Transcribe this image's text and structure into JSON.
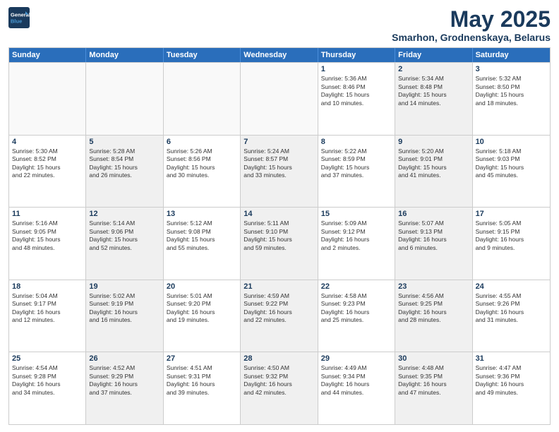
{
  "header": {
    "logo_line1": "General",
    "logo_line2": "Blue",
    "month": "May 2025",
    "location": "Smarhon, Grodnenskaya, Belarus"
  },
  "day_headers": [
    "Sunday",
    "Monday",
    "Tuesday",
    "Wednesday",
    "Thursday",
    "Friday",
    "Saturday"
  ],
  "weeks": [
    [
      {
        "num": "",
        "info": "",
        "empty": true
      },
      {
        "num": "",
        "info": "",
        "empty": true
      },
      {
        "num": "",
        "info": "",
        "empty": true
      },
      {
        "num": "",
        "info": "",
        "empty": true
      },
      {
        "num": "1",
        "info": "Sunrise: 5:36 AM\nSunset: 8:46 PM\nDaylight: 15 hours\nand 10 minutes."
      },
      {
        "num": "2",
        "info": "Sunrise: 5:34 AM\nSunset: 8:48 PM\nDaylight: 15 hours\nand 14 minutes.",
        "shaded": true
      },
      {
        "num": "3",
        "info": "Sunrise: 5:32 AM\nSunset: 8:50 PM\nDaylight: 15 hours\nand 18 minutes."
      }
    ],
    [
      {
        "num": "4",
        "info": "Sunrise: 5:30 AM\nSunset: 8:52 PM\nDaylight: 15 hours\nand 22 minutes."
      },
      {
        "num": "5",
        "info": "Sunrise: 5:28 AM\nSunset: 8:54 PM\nDaylight: 15 hours\nand 26 minutes.",
        "shaded": true
      },
      {
        "num": "6",
        "info": "Sunrise: 5:26 AM\nSunset: 8:56 PM\nDaylight: 15 hours\nand 30 minutes."
      },
      {
        "num": "7",
        "info": "Sunrise: 5:24 AM\nSunset: 8:57 PM\nDaylight: 15 hours\nand 33 minutes.",
        "shaded": true
      },
      {
        "num": "8",
        "info": "Sunrise: 5:22 AM\nSunset: 8:59 PM\nDaylight: 15 hours\nand 37 minutes."
      },
      {
        "num": "9",
        "info": "Sunrise: 5:20 AM\nSunset: 9:01 PM\nDaylight: 15 hours\nand 41 minutes.",
        "shaded": true
      },
      {
        "num": "10",
        "info": "Sunrise: 5:18 AM\nSunset: 9:03 PM\nDaylight: 15 hours\nand 45 minutes."
      }
    ],
    [
      {
        "num": "11",
        "info": "Sunrise: 5:16 AM\nSunset: 9:05 PM\nDaylight: 15 hours\nand 48 minutes."
      },
      {
        "num": "12",
        "info": "Sunrise: 5:14 AM\nSunset: 9:06 PM\nDaylight: 15 hours\nand 52 minutes.",
        "shaded": true
      },
      {
        "num": "13",
        "info": "Sunrise: 5:12 AM\nSunset: 9:08 PM\nDaylight: 15 hours\nand 55 minutes."
      },
      {
        "num": "14",
        "info": "Sunrise: 5:11 AM\nSunset: 9:10 PM\nDaylight: 15 hours\nand 59 minutes.",
        "shaded": true
      },
      {
        "num": "15",
        "info": "Sunrise: 5:09 AM\nSunset: 9:12 PM\nDaylight: 16 hours\nand 2 minutes."
      },
      {
        "num": "16",
        "info": "Sunrise: 5:07 AM\nSunset: 9:13 PM\nDaylight: 16 hours\nand 6 minutes.",
        "shaded": true
      },
      {
        "num": "17",
        "info": "Sunrise: 5:05 AM\nSunset: 9:15 PM\nDaylight: 16 hours\nand 9 minutes."
      }
    ],
    [
      {
        "num": "18",
        "info": "Sunrise: 5:04 AM\nSunset: 9:17 PM\nDaylight: 16 hours\nand 12 minutes."
      },
      {
        "num": "19",
        "info": "Sunrise: 5:02 AM\nSunset: 9:19 PM\nDaylight: 16 hours\nand 16 minutes.",
        "shaded": true
      },
      {
        "num": "20",
        "info": "Sunrise: 5:01 AM\nSunset: 9:20 PM\nDaylight: 16 hours\nand 19 minutes."
      },
      {
        "num": "21",
        "info": "Sunrise: 4:59 AM\nSunset: 9:22 PM\nDaylight: 16 hours\nand 22 minutes.",
        "shaded": true
      },
      {
        "num": "22",
        "info": "Sunrise: 4:58 AM\nSunset: 9:23 PM\nDaylight: 16 hours\nand 25 minutes."
      },
      {
        "num": "23",
        "info": "Sunrise: 4:56 AM\nSunset: 9:25 PM\nDaylight: 16 hours\nand 28 minutes.",
        "shaded": true
      },
      {
        "num": "24",
        "info": "Sunrise: 4:55 AM\nSunset: 9:26 PM\nDaylight: 16 hours\nand 31 minutes."
      }
    ],
    [
      {
        "num": "25",
        "info": "Sunrise: 4:54 AM\nSunset: 9:28 PM\nDaylight: 16 hours\nand 34 minutes."
      },
      {
        "num": "26",
        "info": "Sunrise: 4:52 AM\nSunset: 9:29 PM\nDaylight: 16 hours\nand 37 minutes.",
        "shaded": true
      },
      {
        "num": "27",
        "info": "Sunrise: 4:51 AM\nSunset: 9:31 PM\nDaylight: 16 hours\nand 39 minutes."
      },
      {
        "num": "28",
        "info": "Sunrise: 4:50 AM\nSunset: 9:32 PM\nDaylight: 16 hours\nand 42 minutes.",
        "shaded": true
      },
      {
        "num": "29",
        "info": "Sunrise: 4:49 AM\nSunset: 9:34 PM\nDaylight: 16 hours\nand 44 minutes."
      },
      {
        "num": "30",
        "info": "Sunrise: 4:48 AM\nSunset: 9:35 PM\nDaylight: 16 hours\nand 47 minutes.",
        "shaded": true
      },
      {
        "num": "31",
        "info": "Sunrise: 4:47 AM\nSunset: 9:36 PM\nDaylight: 16 hours\nand 49 minutes."
      }
    ]
  ]
}
